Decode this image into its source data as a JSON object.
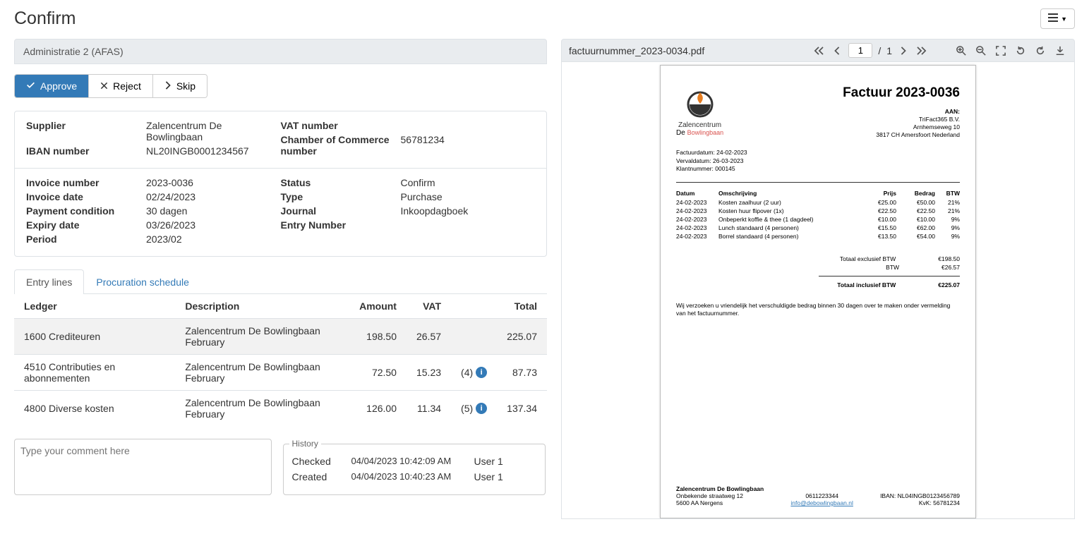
{
  "page_title": "Confirm",
  "admin_label": "Administratie 2 (AFAS)",
  "actions": {
    "approve": "Approve",
    "reject": "Reject",
    "skip": "Skip"
  },
  "details": {
    "supplier_label": "Supplier",
    "supplier": "Zalencentrum De Bowlingbaan",
    "iban_label": "IBAN number",
    "iban": "NL20INGB0001234567",
    "vat_label": "VAT number",
    "vat": "",
    "coc_label": "Chamber of Commerce number",
    "coc": "56781234",
    "invoice_number_label": "Invoice number",
    "invoice_number": "2023-0036",
    "invoice_date_label": "Invoice date",
    "invoice_date": "02/24/2023",
    "payment_condition_label": "Payment condition",
    "payment_condition": "30 dagen",
    "expiry_date_label": "Expiry date",
    "expiry_date": "03/26/2023",
    "period_label": "Period",
    "period": "2023/02",
    "status_label": "Status",
    "status": "Confirm",
    "type_label": "Type",
    "type": "Purchase",
    "journal_label": "Journal",
    "journal": "Inkoopdagboek",
    "entry_number_label": "Entry Number",
    "entry_number": ""
  },
  "tabs": {
    "entry_lines": "Entry lines",
    "procuration": "Procuration schedule"
  },
  "entries": {
    "headers": {
      "ledger": "Ledger",
      "description": "Description",
      "amount": "Amount",
      "vat": "VAT",
      "total": "Total"
    },
    "rows": [
      {
        "ledger": "1600 Crediteuren",
        "description": "Zalencentrum De Bowlingbaan February",
        "amount": "198.50",
        "vat": "26.57",
        "info": "",
        "total": "225.07",
        "hl": true
      },
      {
        "ledger": "4510 Contributies en abonnementen",
        "description": "Zalencentrum De Bowlingbaan February",
        "amount": "72.50",
        "vat": "15.23",
        "info": "(4)",
        "total": "87.73",
        "hl": false
      },
      {
        "ledger": "4800 Diverse kosten",
        "description": "Zalencentrum De Bowlingbaan February",
        "amount": "126.00",
        "vat": "11.34",
        "info": "(5)",
        "total": "137.34",
        "hl": false
      }
    ]
  },
  "comment_placeholder": "Type your comment here",
  "history": {
    "legend": "History",
    "rows": [
      {
        "label": "Checked",
        "ts": "04/04/2023 10:42:09 AM",
        "user": "User 1"
      },
      {
        "label": "Created",
        "ts": "04/04/2023 10:40:23 AM",
        "user": "User 1"
      }
    ]
  },
  "viewer": {
    "filename": "factuurnummer_2023-0034.pdf",
    "page": "1",
    "page_sep": "/",
    "total_pages": "1"
  },
  "pdf": {
    "brand1": "Zalencentrum",
    "brand2": "De Bowlingbaan",
    "title": "Factuur 2023-0036",
    "aan_h": "AAN:",
    "aan_l1": "TriFact365 B.V.",
    "aan_l2": "Arnhemseweg 10",
    "aan_l3": "3817 CH  Amersfoort Nederland",
    "meta1": "Factuurdatum: 24-02-2023",
    "meta2": "Vervaldatum: 26-03-2023",
    "meta3": "Klantnummer: 000145",
    "th_datum": "Datum",
    "th_omschrijving": "Omschrijving",
    "th_prijs": "Prijs",
    "th_bedrag": "Bedrag",
    "th_btw": "BTW",
    "lines": [
      {
        "d": "24-02-2023",
        "o": "Kosten zaalhuur (2 uur)",
        "p": "€25.00",
        "b": "€50.00",
        "w": "21%"
      },
      {
        "d": "24-02-2023",
        "o": "Kosten huur flipover (1x)",
        "p": "€22.50",
        "b": "€22.50",
        "w": "21%"
      },
      {
        "d": "24-02-2023",
        "o": "Onbeperkt koffie & thee (1 dagdeel)",
        "p": "€10.00",
        "b": "€10.00",
        "w": "9%"
      },
      {
        "d": "24-02-2023",
        "o": "Lunch standaard (4 personen)",
        "p": "€15.50",
        "b": "€62.00",
        "w": "9%"
      },
      {
        "d": "24-02-2023",
        "o": "Borrel standaard (4 personen)",
        "p": "€13.50",
        "b": "€54.00",
        "w": "9%"
      }
    ],
    "tot_excl_l": "Totaal exclusief BTW",
    "tot_excl_v": "€198.50",
    "tot_btw_l": "BTW",
    "tot_btw_v": "€26.57",
    "tot_incl_l": "Totaal inclusief BTW",
    "tot_incl_v": "€225.07",
    "note": "Wij verzoeken u vriendelijk het verschuldigde bedrag binnen 30 dagen over te maken onder vermelding van het factuurnummer.",
    "foot_name": "Zalencentrum De Bowlingbaan",
    "foot_addr1": "Onbekende straatweg 12",
    "foot_addr2": "5600 AA  Nergens",
    "foot_tel": "0611223344",
    "foot_email": "info@debowlingbaan.nl",
    "foot_iban": "IBAN: NL04INGB0123456789",
    "foot_kvk": "KvK: 56781234"
  }
}
